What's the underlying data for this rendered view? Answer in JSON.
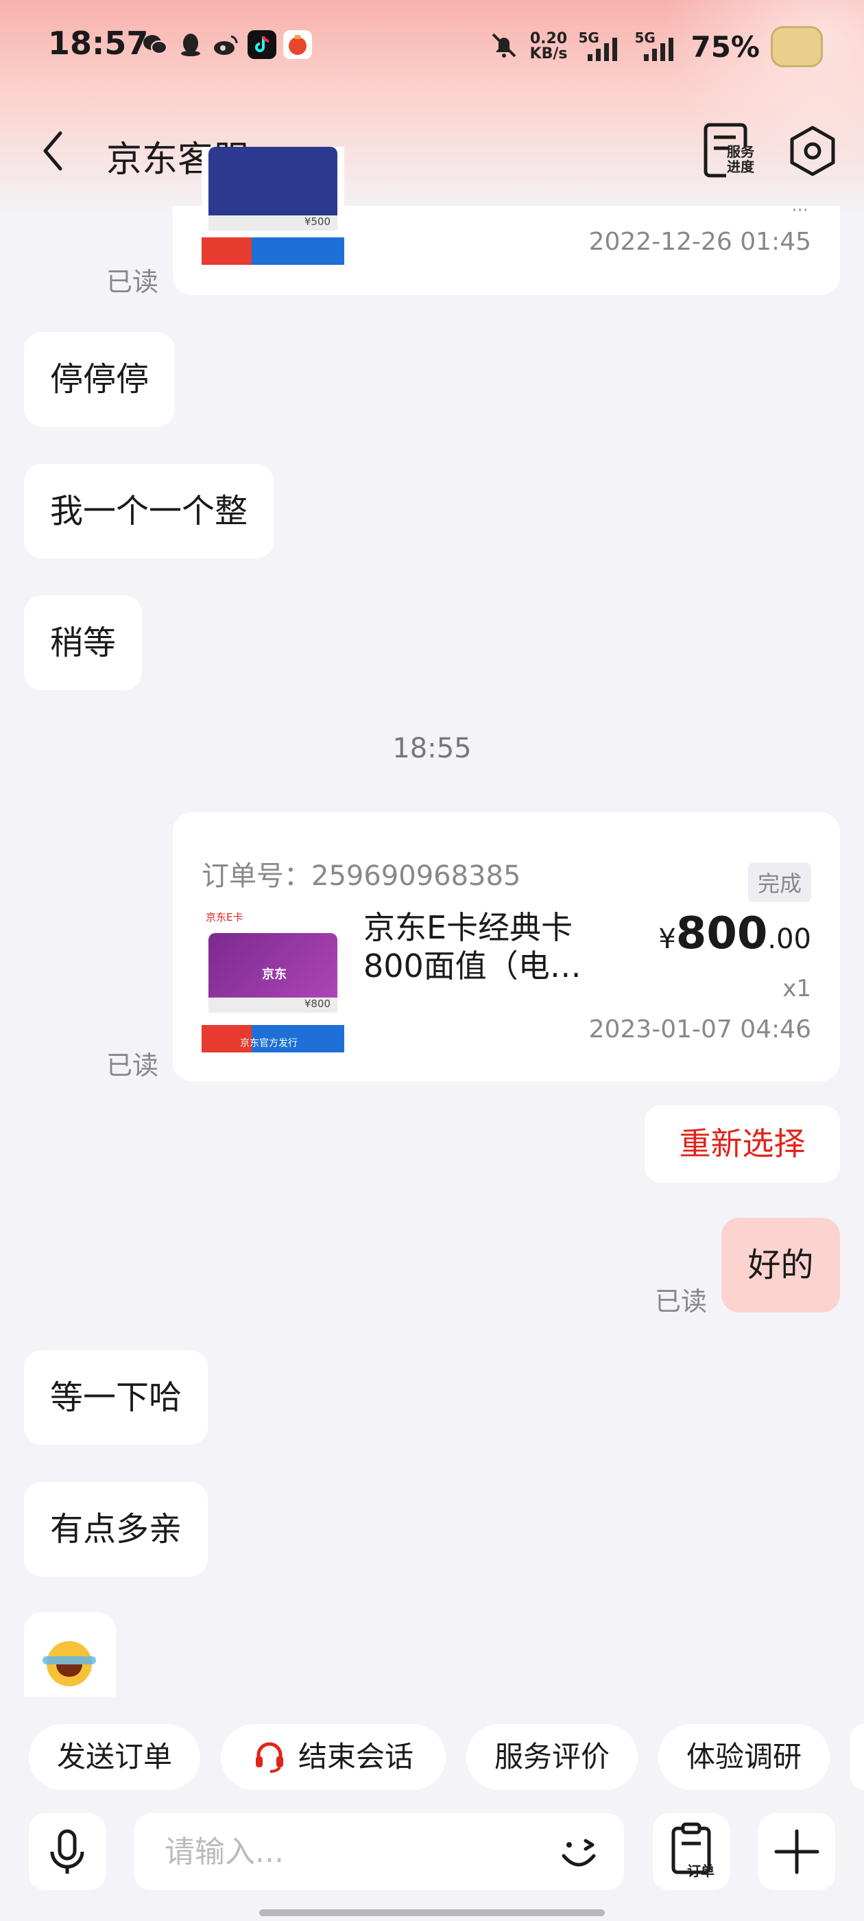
{
  "status_bar": {
    "time": "18:57",
    "net_speed_value": "0.20",
    "net_speed_unit": "KB/s",
    "sim1_label": "5G",
    "sim2_label": "5G",
    "battery": "75%"
  },
  "header": {
    "title": "京东客服",
    "service_progress_label": "服务进度"
  },
  "messages": {
    "prev_card": {
      "thumb_price": "¥500",
      "date": "2022-12-26 01:45",
      "read_status": "已读"
    },
    "agent_msgs": [
      "停停停",
      "我一个一个整",
      "稍等"
    ],
    "time_separator": "18:55",
    "order_card": {
      "order_number": "订单号：259690968385",
      "status": "完成",
      "thumb_brand": "京东E卡",
      "thumb_logo": "京东",
      "thumb_price": "¥800",
      "thumb_banner": "京东官方发行",
      "product_name": "京东E卡经典卡800面值（电…",
      "price_symbol": "¥",
      "price_int": "800",
      "price_dec": ".00",
      "quantity": "x1",
      "date": "2023-01-07 04:46",
      "read_status": "已读"
    },
    "reselect_button": "重新选择",
    "my_msg": "好的",
    "my_msg_read": "已读",
    "agent_msgs_2": [
      "等一下哈",
      "有点多亲"
    ]
  },
  "quick_actions": [
    "发送订单",
    "结束会话",
    "服务评价",
    "体验调研"
  ],
  "input": {
    "placeholder": "请输入...",
    "order_button_label": "订单"
  },
  "colors": {
    "accent_red": "#e2231a",
    "my_bubble": "#fcd3cf",
    "background": "#f4f4f8"
  }
}
